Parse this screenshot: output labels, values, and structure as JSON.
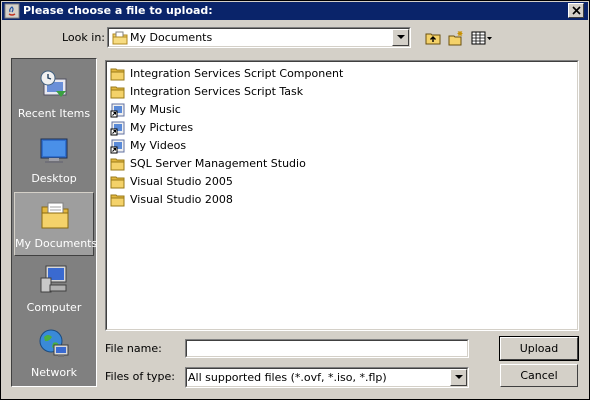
{
  "window": {
    "title": "Please choose a file to upload:"
  },
  "lookin": {
    "label": "Look in:",
    "value": "My Documents"
  },
  "toolbar": {
    "up_icon": "up-one-level-icon",
    "new_folder_icon": "new-folder-icon",
    "view_menu_icon": "view-menu-icon"
  },
  "places": [
    {
      "label": "Recent Items",
      "icon": "recent-items-icon"
    },
    {
      "label": "Desktop",
      "icon": "desktop-icon"
    },
    {
      "label": "My Documents",
      "icon": "my-documents-icon"
    },
    {
      "label": "Computer",
      "icon": "computer-icon"
    },
    {
      "label": "Network",
      "icon": "network-icon"
    }
  ],
  "files": [
    {
      "name": "Integration Services Script Component",
      "type": "folder"
    },
    {
      "name": "Integration Services Script Task",
      "type": "folder"
    },
    {
      "name": "My Music",
      "type": "shortcut"
    },
    {
      "name": "My Pictures",
      "type": "shortcut"
    },
    {
      "name": "My Videos",
      "type": "shortcut"
    },
    {
      "name": "SQL Server Management Studio",
      "type": "folder"
    },
    {
      "name": "Visual Studio 2005",
      "type": "folder"
    },
    {
      "name": "Visual Studio 2008",
      "type": "folder"
    }
  ],
  "filename": {
    "label": "File name:",
    "value": ""
  },
  "filetype": {
    "label": "Files of type:",
    "value": "All supported files (*.ovf, *.iso, *.flp)"
  },
  "buttons": {
    "upload": "Upload",
    "cancel": "Cancel"
  },
  "colors": {
    "titlebar": "#0a246a",
    "dialog_bg": "#d4d0c8",
    "places_bg": "#808080",
    "folder": "#f4d26a"
  }
}
